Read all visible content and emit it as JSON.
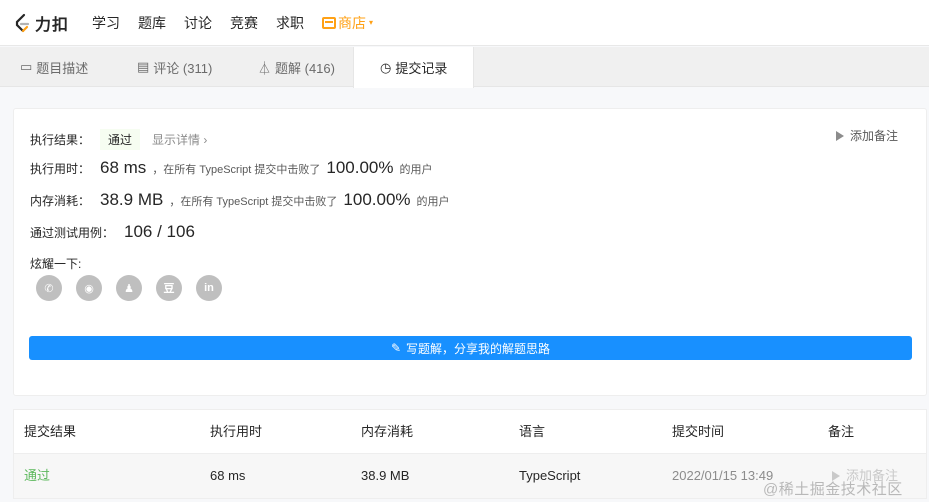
{
  "nav": {
    "logo_text": "力扣",
    "items": [
      "学习",
      "题库",
      "讨论",
      "竞赛",
      "求职"
    ],
    "store_label": "商店",
    "store_caret": "▾"
  },
  "tabs": [
    {
      "label": "题目描述",
      "icon": "description-icon",
      "glyph": "▭"
    },
    {
      "label": "评论 (311)",
      "icon": "comment-icon",
      "glyph": "▤"
    },
    {
      "label": "题解 (416)",
      "icon": "flask-icon",
      "glyph": "⏃"
    },
    {
      "label": "提交记录",
      "icon": "clock-icon",
      "glyph": "◷"
    }
  ],
  "result": {
    "exec_result_label": "执行结果：",
    "status": "通过",
    "show_detail": "显示详情 ›",
    "add_note": "添加备注",
    "time_label": "执行用时：",
    "time_value": "68 ms",
    "time_mid": "，在所有 TypeScript 提交中击败了",
    "time_percent": "100.00%",
    "time_suffix": "的用户",
    "mem_label": "内存消耗：",
    "mem_value": "38.9 MB",
    "mem_mid": "，在所有 TypeScript 提交中击败了",
    "mem_percent": "100.00%",
    "mem_suffix": "的用户",
    "cases_label": "通过测试用例：",
    "cases_value": "106 / 106",
    "share_label": "炫耀一下:",
    "share_icons": [
      "wechat-icon",
      "weibo-icon",
      "qq-icon",
      "douban-icon",
      "linkedin-icon"
    ],
    "share_glyphs": [
      "✆",
      "◉",
      "♟",
      "豆",
      "in"
    ],
    "write_button": "写题解，分享我的解题思路"
  },
  "table": {
    "headers": [
      "提交结果",
      "执行用时",
      "内存消耗",
      "语言",
      "提交时间",
      "备注"
    ],
    "rows": [
      {
        "status": "通过",
        "time": "68 ms",
        "memory": "38.9 MB",
        "language": "TypeScript",
        "submitted": "2022/01/15 13:49",
        "note": "添加备注"
      }
    ]
  },
  "watermark": "@稀土掘金技术社区",
  "colors": {
    "accent": "#1890ff",
    "store": "#ffa116",
    "success": "#5cb85c"
  }
}
